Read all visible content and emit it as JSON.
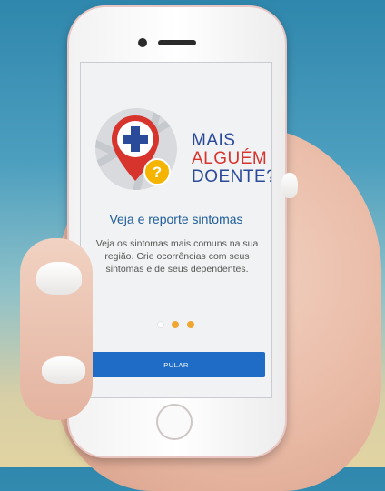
{
  "app": {
    "logo_line1": "MAIS",
    "logo_line2": "ALGUÉM",
    "logo_line3": "DOENTE?"
  },
  "onboarding": {
    "headline": "Veja e reporte sintomas",
    "description": "Veja os sintomas mais comuns na sua região. Crie ocorrências com seus sintomas e de seus dependentes.",
    "pages_total": 3,
    "current_page": 1
  },
  "skip_button": {
    "label": "PULAR"
  },
  "colors": {
    "primary_blue": "#1f6cc6",
    "brand_red": "#d8342e",
    "dot_orange": "#f0a731"
  }
}
